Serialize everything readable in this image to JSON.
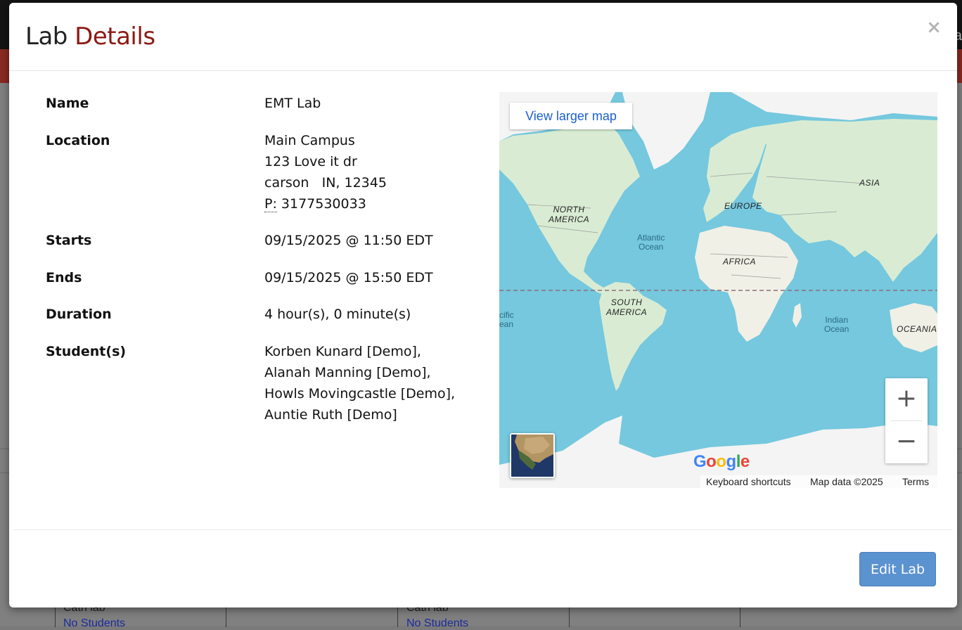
{
  "modal": {
    "title_plain": "Lab",
    "title_accent": "Details",
    "close_glyph": "×"
  },
  "details": {
    "name_label": "Name",
    "name_value": "EMT Lab",
    "location_label": "Location",
    "location_lines": [
      "Main Campus",
      "123 Love it dr",
      "carson   IN, 12345"
    ],
    "phone_prefix": "P:",
    "phone_value": "3177530033",
    "starts_label": "Starts",
    "starts_value": "09/15/2025 @ 11:50 EDT",
    "ends_label": "Ends",
    "ends_value": "09/15/2025 @ 15:50 EDT",
    "duration_label": "Duration",
    "duration_value": "4 hour(s), 0 minute(s)",
    "students_label": "Student(s)",
    "students": [
      "Korben Kunard [Demo],",
      "Alanah Manning [Demo],",
      "Howls Movingcastle [Demo],",
      "Auntie Ruth [Demo]"
    ]
  },
  "map": {
    "larger_map_label": "View larger map",
    "zoom_in": "+",
    "zoom_out": "−",
    "logo_letters": [
      "G",
      "o",
      "o",
      "g",
      "l",
      "e"
    ],
    "logo_colors": [
      "#4285F4",
      "#EA4335",
      "#FBBC05",
      "#4285F4",
      "#34A853",
      "#EA4335"
    ],
    "footer": {
      "shortcuts": "Keyboard shortcuts",
      "data": "Map data ©2025",
      "terms": "Terms"
    },
    "continents": {
      "north_america": "NORTH\nAMERICA",
      "south_america": "SOUTH\nAMERICA",
      "europe": "EUROPE",
      "africa": "AFRICA",
      "asia": "ASIA",
      "oceania": "OCEANIA"
    },
    "oceans": {
      "atlantic": "Atlantic\nOcean",
      "indian": "Indian\nOcean",
      "pacific_partial": "cific\nean"
    },
    "colors": {
      "water": "#75c8de",
      "land": "#d9ecd3",
      "ice": "#f4f4f4"
    }
  },
  "footer": {
    "edit_button": "Edit Lab"
  },
  "background": {
    "cell_text_1": "Cath lab",
    "cell_link_1": "No Students",
    "cell_text_2": "Cath lab",
    "cell_link_2": "No Students",
    "right_partial": "a"
  }
}
